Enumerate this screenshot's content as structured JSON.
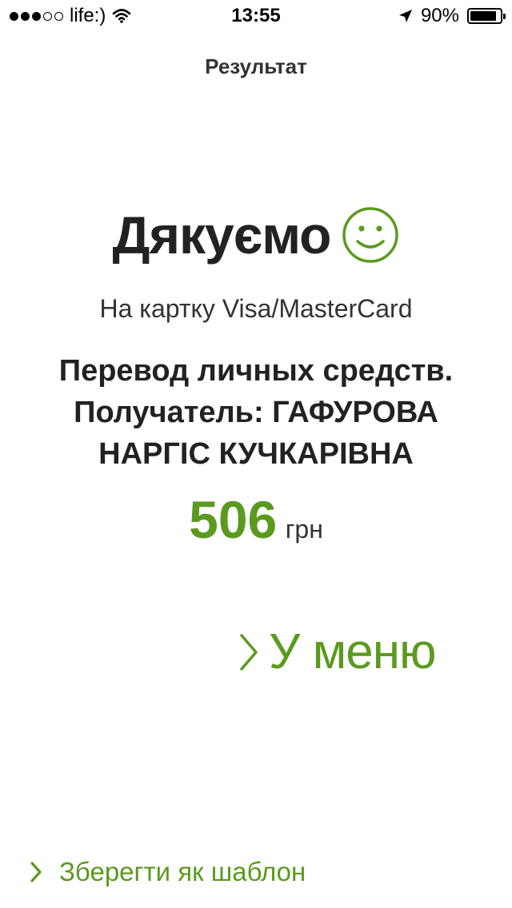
{
  "status_bar": {
    "carrier": "life:)",
    "time": "13:55",
    "battery_percent": "90%",
    "battery_level": 0.9,
    "signal_bars_filled": 3,
    "signal_bars_total": 5,
    "icons": [
      "wifi-icon",
      "location-arrow-icon",
      "battery-icon"
    ]
  },
  "header": {
    "title": "Результат"
  },
  "result": {
    "thanks": "Дякуємо",
    "thanks_icon": "smiley-icon",
    "card_line": "На картку Visa/MasterCard",
    "description_lines": [
      "Перевод личных средств.",
      "Получатель: ГАФУРОВА",
      "НАРГІС КУЧКАРІВНА"
    ],
    "amount": "506",
    "currency": "грн"
  },
  "actions": {
    "menu_label": "У меню",
    "save_template_label": "Зберегти як шаблон"
  },
  "colors": {
    "accent": "#5a9a1f",
    "text": "#222222"
  }
}
